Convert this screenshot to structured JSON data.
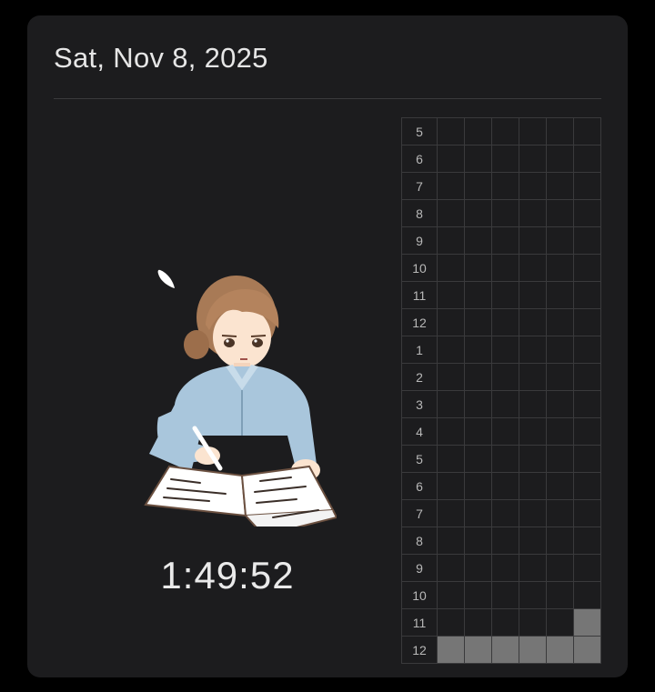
{
  "header": {
    "date": "Sat, Nov 8, 2025"
  },
  "timer": {
    "elapsed": "1:49:52"
  },
  "illustration": {
    "icon": "studying-girl-illustration"
  },
  "colors": {
    "card_background": "#1c1c1e",
    "grid_line": "#3a3a3c",
    "filled_cell": "#767676",
    "text": "#e6e6e6"
  },
  "activity_grid": {
    "columns_per_hour": 6,
    "rows": [
      {
        "hour": "5",
        "filled": [
          0,
          0,
          0,
          0,
          0,
          0
        ]
      },
      {
        "hour": "6",
        "filled": [
          0,
          0,
          0,
          0,
          0,
          0
        ]
      },
      {
        "hour": "7",
        "filled": [
          0,
          0,
          0,
          0,
          0,
          0
        ]
      },
      {
        "hour": "8",
        "filled": [
          0,
          0,
          0,
          0,
          0,
          0
        ]
      },
      {
        "hour": "9",
        "filled": [
          0,
          0,
          0,
          0,
          0,
          0
        ]
      },
      {
        "hour": "10",
        "filled": [
          0,
          0,
          0,
          0,
          0,
          0
        ]
      },
      {
        "hour": "11",
        "filled": [
          0,
          0,
          0,
          0,
          0,
          0
        ]
      },
      {
        "hour": "12",
        "filled": [
          0,
          0,
          0,
          0,
          0,
          0
        ]
      },
      {
        "hour": "1",
        "filled": [
          0,
          0,
          0,
          0,
          0,
          0
        ]
      },
      {
        "hour": "2",
        "filled": [
          0,
          0,
          0,
          0,
          0,
          0
        ]
      },
      {
        "hour": "3",
        "filled": [
          0,
          0,
          0,
          0,
          0,
          0
        ]
      },
      {
        "hour": "4",
        "filled": [
          0,
          0,
          0,
          0,
          0,
          0
        ]
      },
      {
        "hour": "5",
        "filled": [
          0,
          0,
          0,
          0,
          0,
          0
        ]
      },
      {
        "hour": "6",
        "filled": [
          0,
          0,
          0,
          0,
          0,
          0
        ]
      },
      {
        "hour": "7",
        "filled": [
          0,
          0,
          0,
          0,
          0,
          0
        ]
      },
      {
        "hour": "8",
        "filled": [
          0,
          0,
          0,
          0,
          0,
          0
        ]
      },
      {
        "hour": "9",
        "filled": [
          0,
          0,
          0,
          0,
          0,
          0
        ]
      },
      {
        "hour": "10",
        "filled": [
          0,
          0,
          0,
          0,
          0,
          0
        ]
      },
      {
        "hour": "11",
        "filled": [
          0,
          0,
          0,
          0,
          0,
          1
        ]
      },
      {
        "hour": "12",
        "filled": [
          1,
          1,
          1,
          1,
          1,
          1
        ]
      }
    ]
  }
}
